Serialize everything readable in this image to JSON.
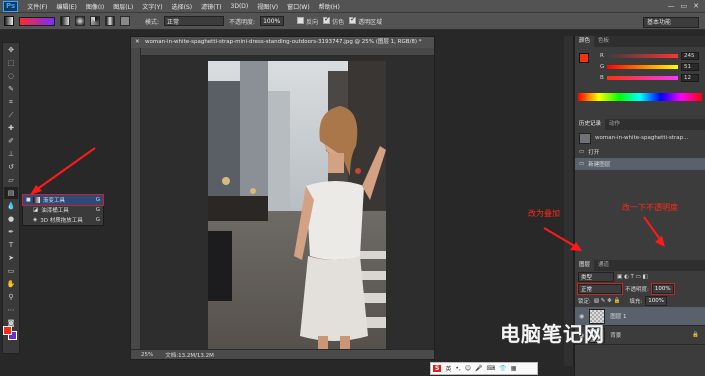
{
  "app": {
    "logo": "Ps"
  },
  "menu": [
    "文件(F)",
    "编辑(E)",
    "图像(I)",
    "图层(L)",
    "文字(Y)",
    "选择(S)",
    "滤镜(T)",
    "3D(D)",
    "视图(V)",
    "窗口(W)",
    "帮助(H)"
  ],
  "window_controls": [
    "—",
    "▭",
    "✕"
  ],
  "options": {
    "mode_label": "模式:",
    "mode_value": "正常",
    "opacity_label": "不透明度:",
    "opacity_value": "100%",
    "reverse_label": "反向",
    "dither_label": "仿色",
    "transparency_label": "透明区域",
    "workspace": "基本功能"
  },
  "flyout": {
    "items": [
      {
        "label": "渐变工具",
        "key": "G"
      },
      {
        "label": "油漆桶工具",
        "key": "G"
      },
      {
        "label": "3D 材质拖放工具",
        "key": "G"
      }
    ]
  },
  "document": {
    "title": "woman-in-white-spaghetti-strap-mini-dress-standing-outdoors-3193747.jpg @ 25% (图层 1, RGB/8) *",
    "zoom": "25%",
    "doc_info": "文档:13.2M/13.2M"
  },
  "color_panel": {
    "tabs": [
      "颜色",
      "色板"
    ],
    "r": "245",
    "g": "51",
    "b": "12",
    "r_label": "R",
    "g_label": "G",
    "b_label": "B"
  },
  "history_panel": {
    "tabs": [
      "历史记录",
      "动作"
    ],
    "snapshot": "woman-in-white-spaghetti-strap...",
    "items": [
      "打开",
      "新建图层"
    ]
  },
  "layers_panel": {
    "tabs": [
      "图层",
      "通道"
    ],
    "kind": "类型",
    "blend": "正常",
    "opacity_label": "不透明度:",
    "opacity": "100%",
    "lock_label": "锁定:",
    "fill_label": "填充:",
    "fill": "100%",
    "layers": [
      {
        "name": "图层 1"
      },
      {
        "name": "背景"
      }
    ]
  },
  "annotations": {
    "left": "改为叠加",
    "right": "改一下不透明度"
  },
  "watermark": "电脑笔记网",
  "ime": {
    "label": "英"
  }
}
